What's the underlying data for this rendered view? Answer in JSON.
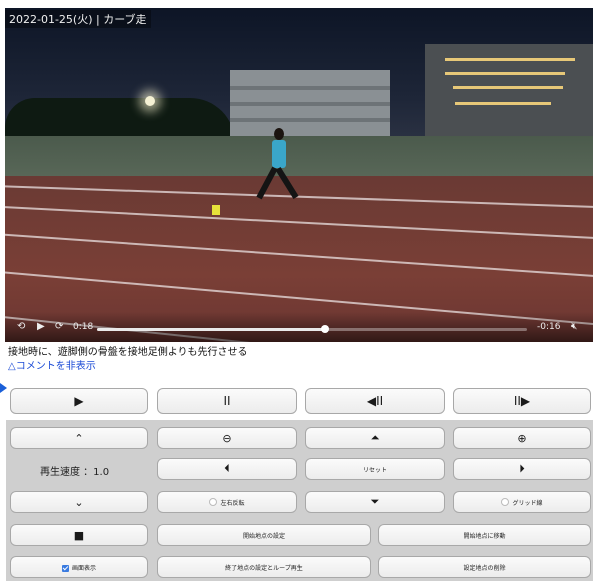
{
  "video": {
    "timestamp_label": "2022-01-25(火) | カーブ走",
    "controls": {
      "rewind_icon": "rewind-15-icon",
      "play_icon": "play-icon",
      "forward_icon": "forward-15-icon",
      "elapsed": "0:18",
      "remaining": "-0:16",
      "progress": 0.53,
      "mute_icon": "speaker-muted-icon"
    }
  },
  "caption": "接地時に、遊脚側の骨盤を接地足側よりも先行させる",
  "comment_toggle": "△コメントを非表示",
  "transport": [
    "▶",
    "II",
    "◀II",
    "II▶"
  ],
  "panel": {
    "speed_label": "再生速度 ：1.0",
    "reset_label": "リセット",
    "mirror_label": "左右反転",
    "grid_label": "グリッド線",
    "set_start_label": "開始地点の設定",
    "goto_start_label": "開始地点に移動",
    "set_end_loop_label": "終了地点の設定とループ再生",
    "clear_points_label": "設定地点の削除",
    "screen_display_label": "画面表示",
    "screen_display_checked": true
  },
  "colors": {
    "link": "#1a4ad6",
    "panel_bg": "#cfcfcf",
    "checkbox": "#3a7be0"
  }
}
